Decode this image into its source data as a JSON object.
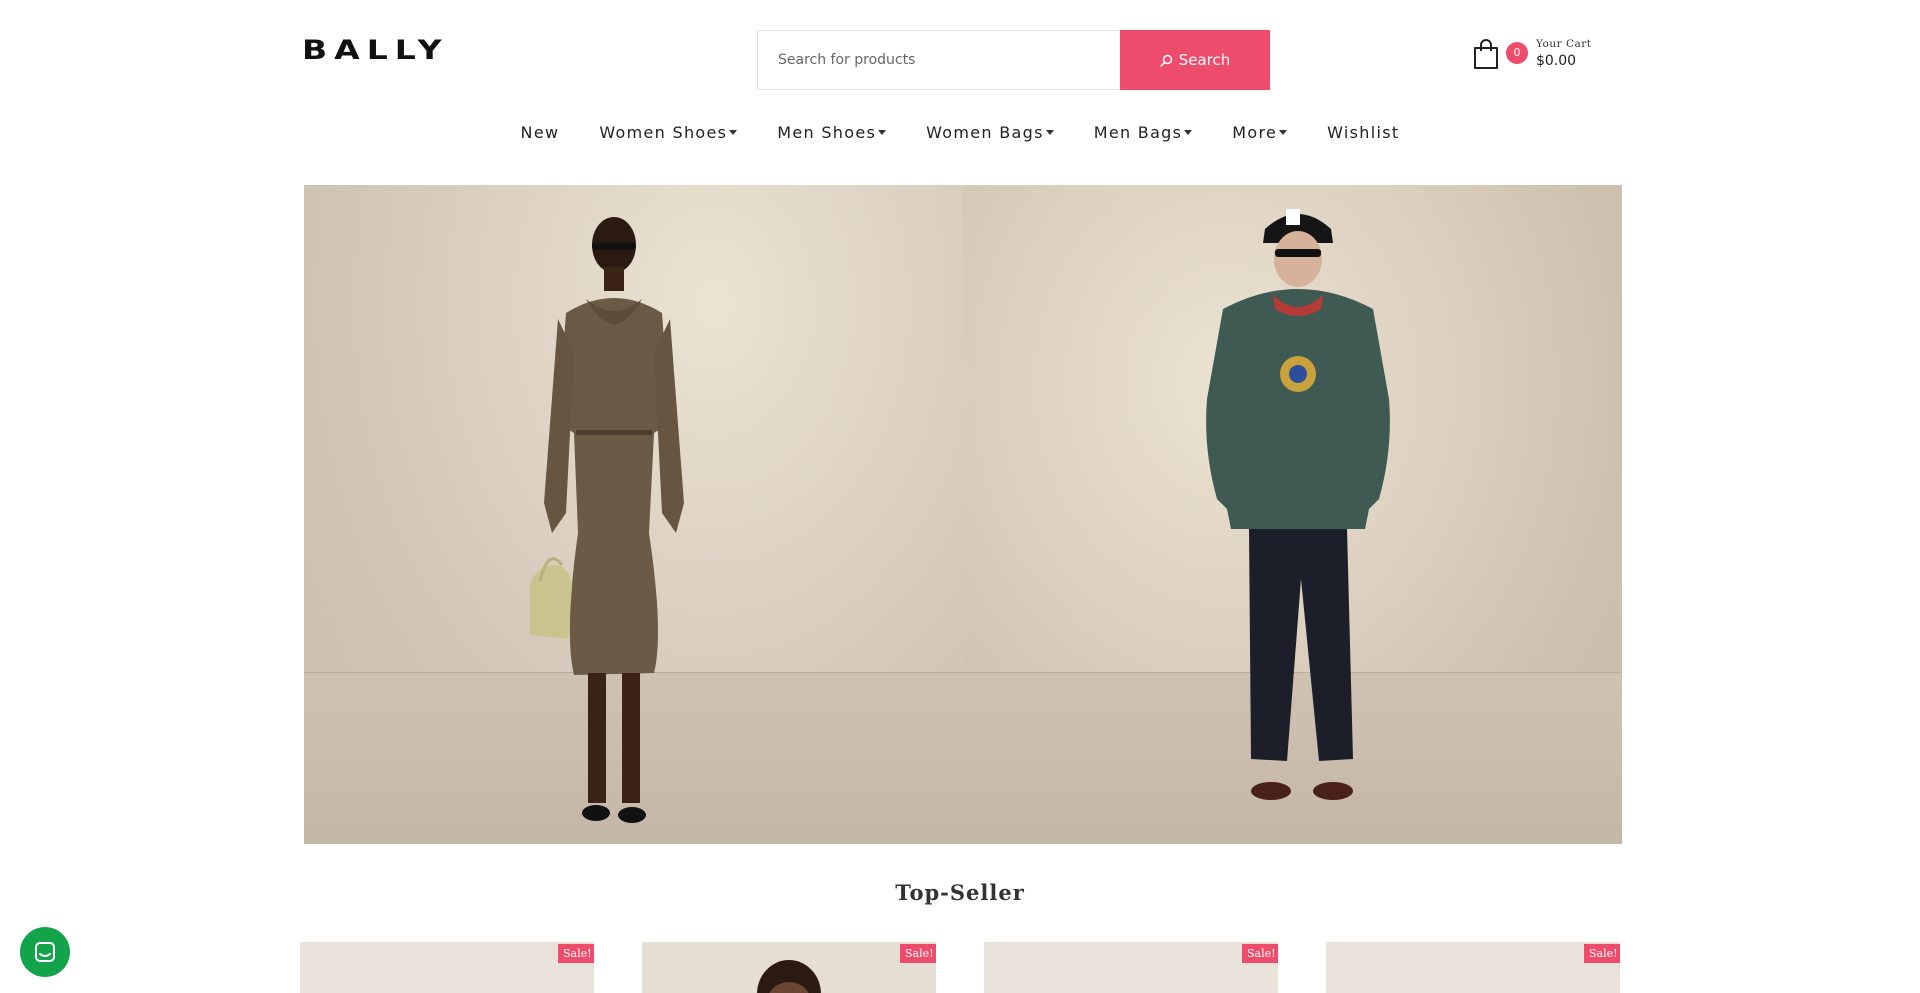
{
  "header": {
    "logo_text": "BALLY",
    "search": {
      "placeholder": "Search for products",
      "button_label": "Search"
    },
    "cart": {
      "count": "0",
      "label": "Your Cart",
      "total": "$0.00"
    }
  },
  "nav": {
    "items": [
      {
        "label": "New",
        "has_dropdown": false
      },
      {
        "label": "Women Shoes",
        "has_dropdown": true
      },
      {
        "label": "Men Shoes",
        "has_dropdown": true
      },
      {
        "label": "Women Bags",
        "has_dropdown": true
      },
      {
        "label": "Men Bags",
        "has_dropdown": true
      },
      {
        "label": "More",
        "has_dropdown": true
      },
      {
        "label": "Wishlist",
        "has_dropdown": false
      }
    ]
  },
  "main": {
    "section_title": "Top-Seller",
    "products": [
      {
        "badge": "Sale!"
      },
      {
        "badge": "Sale!"
      },
      {
        "badge": "Sale!"
      },
      {
        "badge": "Sale!"
      }
    ]
  },
  "colors": {
    "accent": "#ee4c6d",
    "chat": "#13a34a"
  },
  "icons": {
    "search": "search-icon",
    "cart": "shopping-bag-icon",
    "chat": "chat-icon"
  }
}
